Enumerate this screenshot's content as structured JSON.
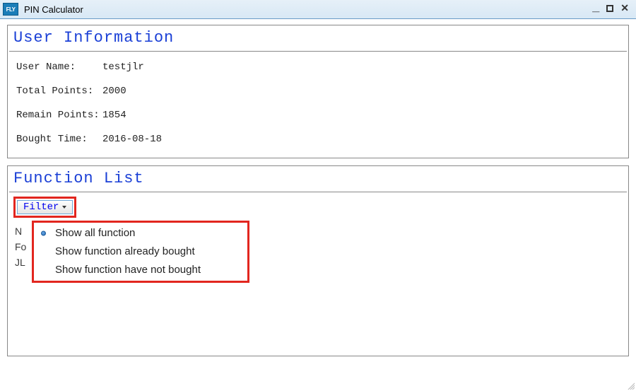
{
  "window": {
    "title": "PIN Calculator",
    "logo_text": "FLY"
  },
  "user_info": {
    "heading": "User Information",
    "rows": [
      {
        "label": "User Name:",
        "value": "testjlr"
      },
      {
        "label": "Total Points:",
        "value": "2000"
      },
      {
        "label": "Remain Points:",
        "value": "1854"
      },
      {
        "label": "Bought Time:",
        "value": "2016-08-18"
      }
    ]
  },
  "function_list": {
    "heading": "Function List",
    "filter_button": "Filter",
    "bg_lines": [
      "N",
      "Fo",
      "JL"
    ],
    "dropdown": [
      "Show all function",
      "Show function already bought",
      "Show function have not bought"
    ],
    "selected_index": 0
  }
}
